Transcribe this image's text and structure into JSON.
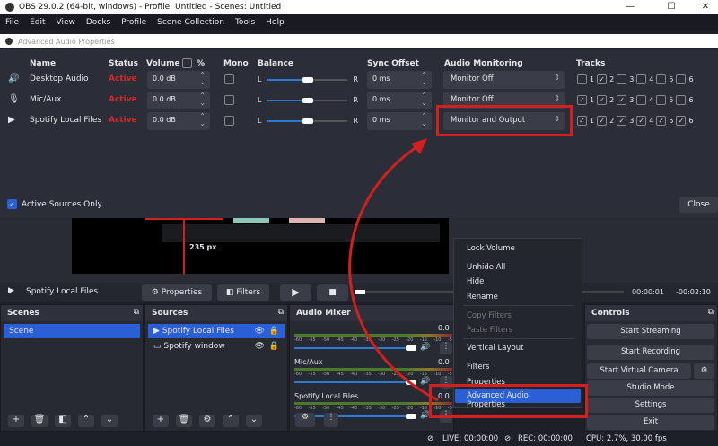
{
  "window": {
    "title": "OBS 29.0.2 (64-bit, windows) - Profile: Untitled - Scenes: Untitled",
    "min": "—",
    "max": "☐",
    "close": "✕"
  },
  "menu": [
    "File",
    "Edit",
    "View",
    "Docks",
    "Profile",
    "Scene Collection",
    "Tools",
    "Help"
  ],
  "dialog": {
    "title": "Advanced Audio Properties",
    "headers": {
      "name": "Name",
      "status": "Status",
      "volume": "Volume",
      "percent": "%",
      "mono": "Mono",
      "balance": "Balance",
      "sync": "Sync Offset",
      "monitoring": "Audio Monitoring",
      "tracks": "Tracks"
    },
    "rows": [
      {
        "icon": "speaker-icon",
        "glyph": "🔊",
        "name": "Desktop Audio",
        "status": "Active",
        "volume": "0.0 dB",
        "balance_l": "L",
        "balance_r": "R",
        "sync": "0 ms",
        "monitoring": "Monitor Off",
        "tracks": [
          false,
          true,
          false,
          false,
          false,
          false
        ]
      },
      {
        "icon": "microphone-icon",
        "glyph": "🎙",
        "name": "Mic/Aux",
        "status": "Active",
        "volume": "0.0 dB",
        "balance_l": "L",
        "balance_r": "R",
        "sync": "0 ms",
        "monitoring": "Monitor Off",
        "tracks": [
          true,
          true,
          true,
          false,
          false,
          false
        ]
      },
      {
        "icon": "play-icon",
        "glyph": "▶",
        "name": "Spotify Local Files",
        "status": "Active",
        "volume": "0.0 dB",
        "balance_l": "L",
        "balance_r": "R",
        "sync": "0 ms",
        "monitoring": "Monitor and Output",
        "tracks": [
          true,
          true,
          true,
          true,
          true,
          true
        ]
      }
    ],
    "track_labels": [
      "1",
      "2",
      "3",
      "4",
      "5",
      "6"
    ],
    "active_only": "Active Sources Only",
    "close": "Close"
  },
  "preview": {
    "measure": "235 px"
  },
  "source_bar": {
    "name": "Spotify Local Files",
    "properties": "Properties",
    "filters": "Filters",
    "time_start": "00:00:01",
    "time_end": "-00:02:10"
  },
  "scenes": {
    "title": "Scenes",
    "items": [
      "Scene"
    ]
  },
  "sources": {
    "title": "Sources",
    "items": [
      "Spotify Local Files",
      "Spotify window"
    ]
  },
  "mixer": {
    "title": "Audio Mixer",
    "channels": [
      {
        "name": "",
        "db": "0.0"
      },
      {
        "name": "Mic/Aux",
        "db": "0.0"
      },
      {
        "name": "Spotify Local Files",
        "db": "0.0"
      }
    ],
    "ticks": [
      "-60",
      "-55",
      "-50",
      "-45",
      "-40",
      "-35",
      "-30",
      "-25",
      "-20",
      "-15",
      "-10",
      "-5"
    ]
  },
  "context_menu": {
    "items": [
      "Lock Volume",
      "Unhide All",
      "Hide",
      "Rename",
      "Copy Filters",
      "Paste Filters",
      "Vertical Layout",
      "Filters",
      "Properties",
      "Advanced Audio Properties"
    ]
  },
  "controls": {
    "title": "Controls",
    "start_streaming": "Start Streaming",
    "start_recording": "Start Recording",
    "virtual_camera": "Start Virtual Camera",
    "studio_mode": "Studio Mode",
    "settings": "Settings",
    "exit": "Exit"
  },
  "status": {
    "live": "LIVE: 00:00:00",
    "rec": "REC: 00:00:00",
    "cpu": "CPU: 2.7%, 30.00 fps"
  },
  "colors": {
    "accent": "#2a5fd6",
    "annotation": "#d21f1f",
    "active": "#d42a2a"
  }
}
